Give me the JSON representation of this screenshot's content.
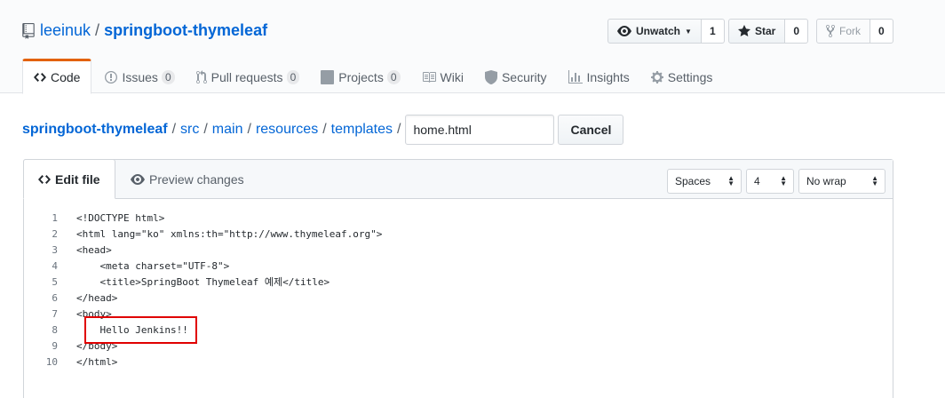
{
  "repo": {
    "owner": "leeinuk",
    "name": "springboot-thymeleaf",
    "separator": "/"
  },
  "actions": {
    "watch": {
      "label": "Unwatch",
      "count": "1"
    },
    "star": {
      "label": "Star",
      "count": "0"
    },
    "fork": {
      "label": "Fork",
      "count": "0"
    }
  },
  "nav": {
    "code": "Code",
    "issues": {
      "label": "Issues",
      "count": "0"
    },
    "pulls": {
      "label": "Pull requests",
      "count": "0"
    },
    "projects": {
      "label": "Projects",
      "count": "0"
    },
    "wiki": "Wiki",
    "security": "Security",
    "insights": "Insights",
    "settings": "Settings"
  },
  "breadcrumb": {
    "root": "springboot-thymeleaf",
    "parts": [
      "src",
      "main",
      "resources",
      "templates"
    ],
    "sep": "/",
    "filename": "home.html",
    "cancel": "Cancel"
  },
  "editor": {
    "tab_edit": "Edit file",
    "tab_preview": "Preview changes",
    "indent_mode": "Spaces",
    "indent_size": "4",
    "wrap_mode": "No wrap",
    "lines": [
      {
        "n": "1",
        "text": "<!DOCTYPE html>"
      },
      {
        "n": "2",
        "text": "<html lang=\"ko\" xmlns:th=\"http://www.thymeleaf.org\">"
      },
      {
        "n": "3",
        "text": "<head>"
      },
      {
        "n": "4",
        "text": "    <meta charset=\"UTF-8\">"
      },
      {
        "n": "5",
        "text": "    <title>SpringBoot Thymeleaf 예제</title>"
      },
      {
        "n": "6",
        "text": "</head>"
      },
      {
        "n": "7",
        "text": "<body>"
      },
      {
        "n": "8",
        "text": "    Hello Jenkins!!"
      },
      {
        "n": "9",
        "text": "</body>"
      },
      {
        "n": "10",
        "text": "</html>"
      }
    ]
  },
  "colors": {
    "link": "#0366d6",
    "tab_accent": "#e36209",
    "highlight_box": "#e00000"
  }
}
